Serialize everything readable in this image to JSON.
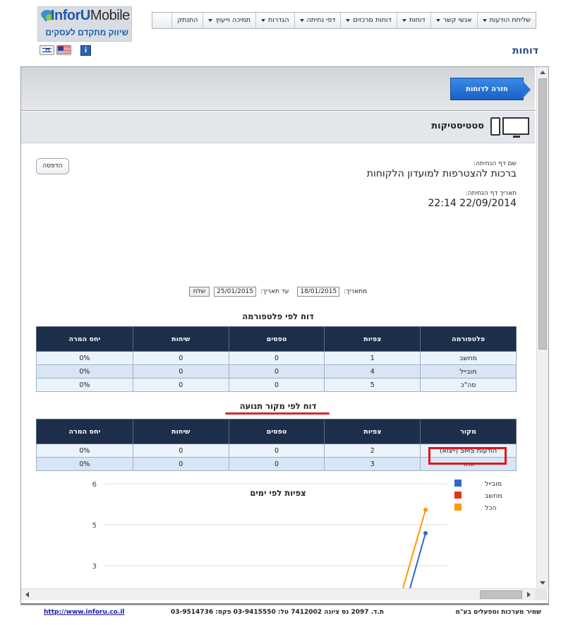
{
  "brand": {
    "name_inforu": "InforU",
    "name_mobile": "Mobile",
    "tagline": "שיווק מתקדם לעסקים"
  },
  "top_menu": [
    {
      "label": "שליחת הודעות",
      "dropdown": true
    },
    {
      "label": "אנשי קשר",
      "dropdown": true
    },
    {
      "label": "דוחות",
      "dropdown": true
    },
    {
      "label": "דוחות מרכזים",
      "dropdown": true
    },
    {
      "label": "דפי נחיתה",
      "dropdown": true
    },
    {
      "label": "הגדרות",
      "dropdown": true
    },
    {
      "label": "תמיכה וייעוץ",
      "dropdown": true
    },
    {
      "label": "התנתק",
      "dropdown": false
    }
  ],
  "icons": {
    "flag_hebrew": "israel-flag-icon",
    "flag_english": "us-flag-icon",
    "info": "info-icon",
    "info_glyph": "i"
  },
  "page_title": "דוחות",
  "back_button": "חזרה לדוחות",
  "section_title": "סטטיסטיקות",
  "print_button": "הדפסה",
  "landing_page": {
    "name_label": "שם דף הנחיתה:",
    "name_value": "ברכות להצטרפות למועדון הלקוחות",
    "date_label": "תאריך דף הנחיתה:",
    "date_value": "22/09/2014 22:14"
  },
  "date_filter": {
    "from_label": "מתאריך:",
    "from_value": "18/01/2015",
    "to_label": "עד תאריך:",
    "to_value": "25/01/2015",
    "send_label": "שלח"
  },
  "platform_report": {
    "title": "דוח לפי פלטפורמה",
    "headers": [
      "פלטפורמה",
      "צפיות",
      "טפסים",
      "שיחות",
      "יחס המרה"
    ],
    "rows": [
      [
        "מחשב",
        "1",
        "0",
        "0",
        "0%"
      ],
      [
        "מובייל",
        "4",
        "0",
        "0",
        "0%"
      ],
      [
        "סה\"כ",
        "5",
        "0",
        "0",
        "0%"
      ]
    ]
  },
  "source_report": {
    "title": "דוח לפי מקור תנועה",
    "headers": [
      "מקור",
      "צפיות",
      "טפסים",
      "שיחות",
      "יחס המרה"
    ],
    "rows": [
      [
        "הודעות SMS (ייצוא)",
        "2",
        "0",
        "0",
        "0%"
      ],
      [
        "אחר",
        "3",
        "0",
        "0",
        "0%"
      ]
    ]
  },
  "chart_data": {
    "type": "line",
    "title": "צפיות לפי ימים",
    "y_ticks": [
      "6",
      "5",
      "3"
    ],
    "ylim": [
      3,
      6
    ],
    "grid": true,
    "legend_position": "top-right",
    "series": [
      {
        "name": "מובייל",
        "color": "#3366cc"
      },
      {
        "name": "מחשב",
        "color": "#dc3912"
      },
      {
        "name": "הכל",
        "color": "#ff9900"
      }
    ]
  },
  "footer": {
    "company": "שמיר מערכות ומפעלים בע\"מ",
    "contact": "ת.ד. 2097 נס ציונה 7412002   טל: 03-9415550   פקס: 03-9514736",
    "website": "http://www.inforu.co.il"
  }
}
